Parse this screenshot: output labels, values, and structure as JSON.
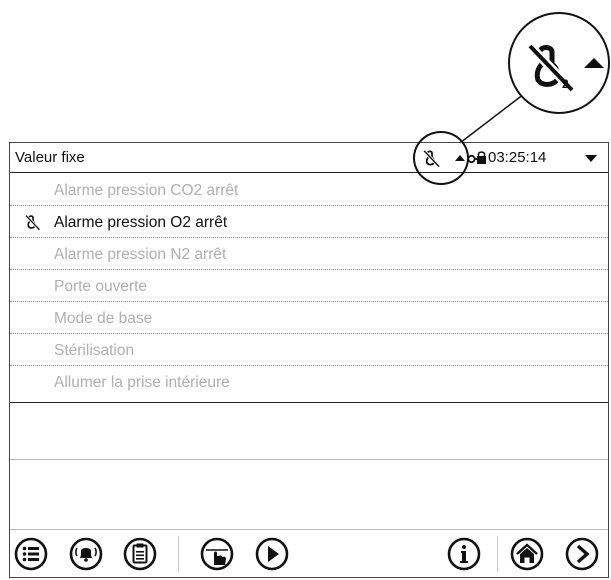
{
  "header": {
    "title": "Valeur fixe",
    "time": "03:25:14"
  },
  "menu": {
    "items": [
      {
        "label": "Alarme pression CO2 arrêt",
        "active": false
      },
      {
        "label": "Alarme pression O2 arrêt",
        "active": true,
        "icon": "alarm-off-icon"
      },
      {
        "label": "Alarme pression N2 arrêt",
        "active": false
      },
      {
        "label": "Porte ouverte",
        "active": false
      },
      {
        "label": "Mode de base",
        "active": false
      },
      {
        "label": "Stérilisation",
        "active": false
      },
      {
        "label": "Allumer la prise intérieure",
        "active": false
      }
    ]
  },
  "toolbar": {
    "buttons": [
      "menu-icon",
      "alarm-bell-icon",
      "clipboard-icon",
      "manual-hand-icon",
      "play-icon",
      "info-icon",
      "home-icon",
      "next-arrow-icon"
    ]
  },
  "colors": {
    "active_text": "#111111",
    "inactive_text": "#b0b0b0",
    "border": "#222222"
  }
}
